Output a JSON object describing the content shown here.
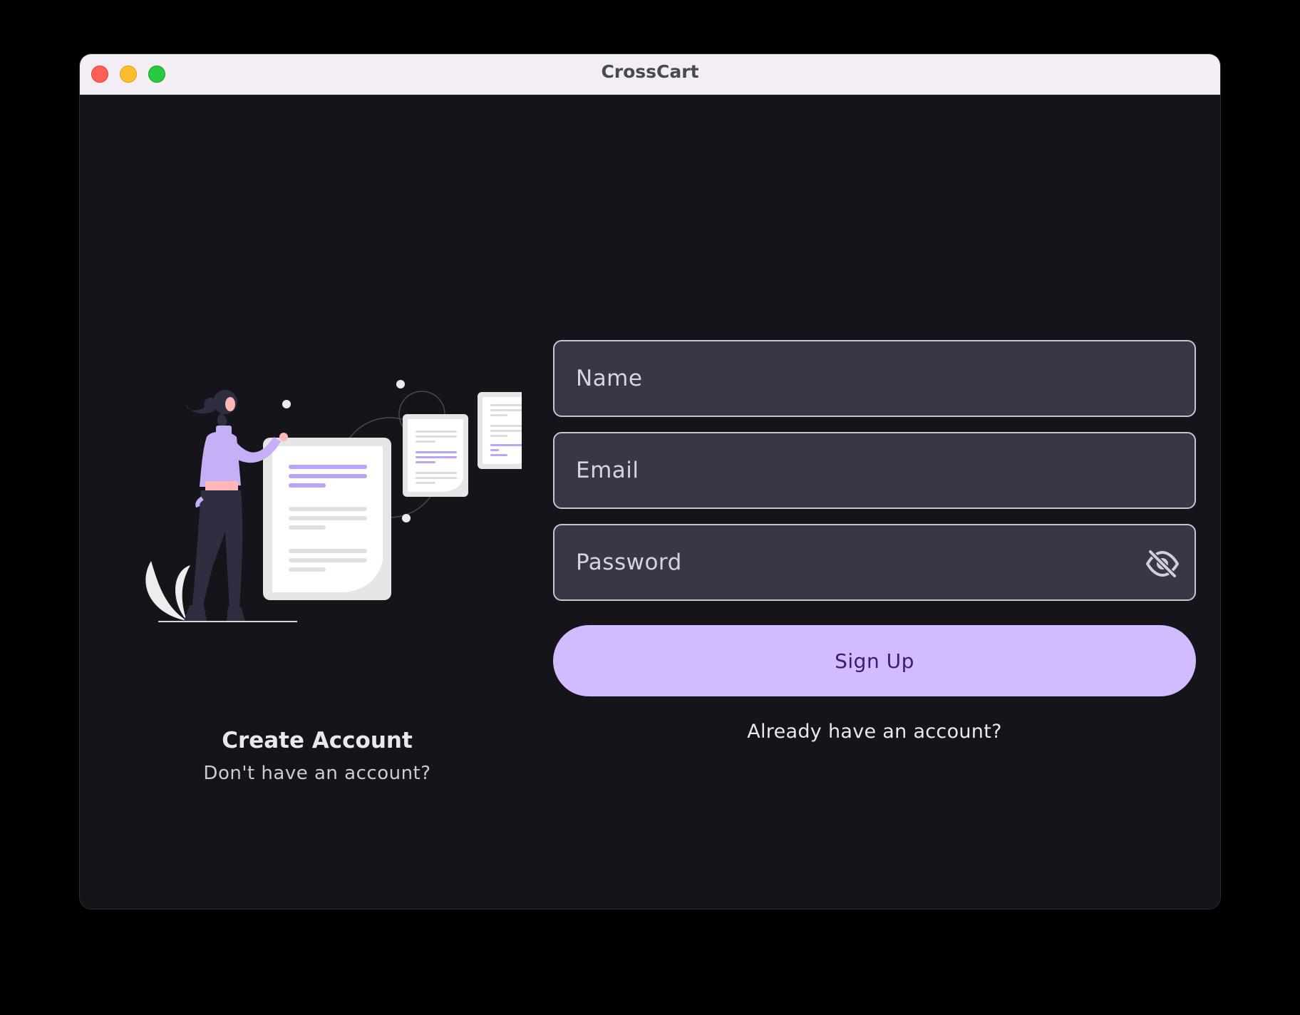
{
  "window": {
    "title": "CrossCart"
  },
  "left_panel": {
    "title": "Create Account",
    "subtitle": "Don't have an account?"
  },
  "form": {
    "name_placeholder": "Name",
    "email_placeholder": "Email",
    "password_placeholder": "Password",
    "password_toggle_icon": "eye-off-icon",
    "signup_label": "Sign Up",
    "login_link": "Already have an account?"
  },
  "colors": {
    "background": "#15141a",
    "field_bg": "#3b3548",
    "primary": "#d0bcff",
    "on_primary": "#381e72",
    "illustration_accent": "#b9a4f5"
  }
}
